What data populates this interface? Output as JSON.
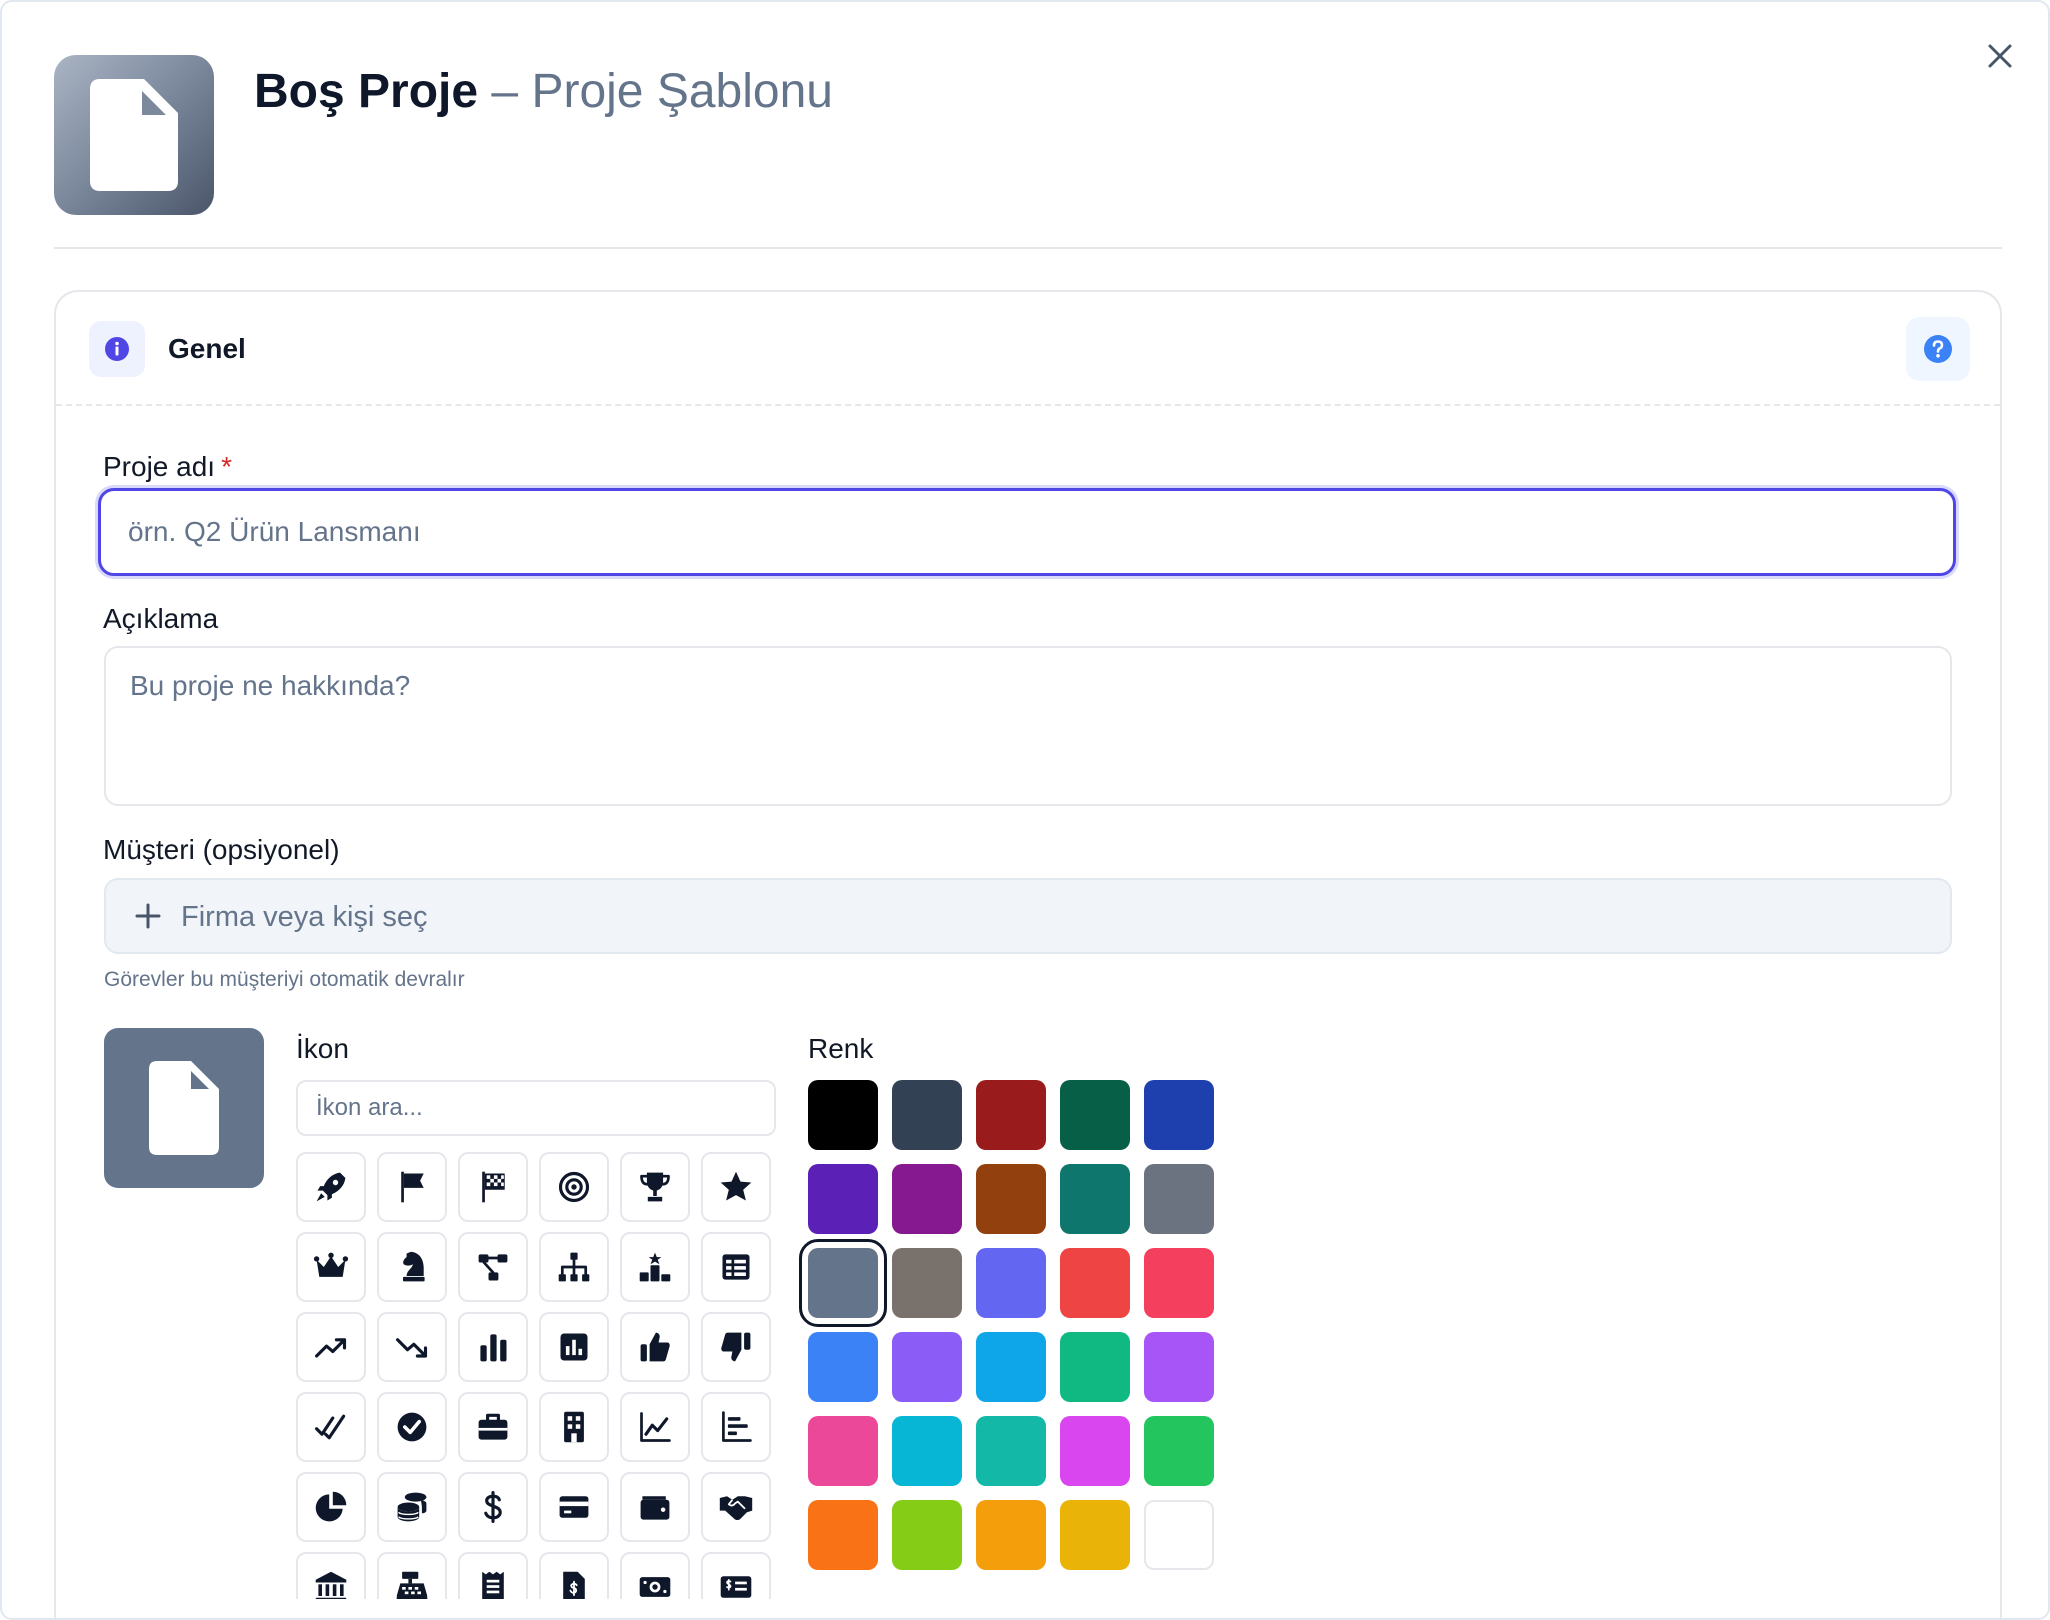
{
  "header": {
    "title": "Boş Proje",
    "separator": " – ",
    "subtitle": "Proje Şablonu",
    "icon": "file-icon",
    "close_icon": "close-icon"
  },
  "section": {
    "title": "Genel",
    "info_icon": "info-icon",
    "help_icon": "help-icon"
  },
  "form": {
    "name_label": "Proje adı",
    "required_mark": "*",
    "name_value": "",
    "name_placeholder": "örn. Q2 Ürün Lansmanı",
    "description_label": "Açıklama",
    "description_value": "",
    "description_placeholder": "Bu proje ne hakkında?",
    "client_label": "Müşteri (opsiyonel)",
    "client_placeholder": "Firma veya kişi seç",
    "client_help": "Görevler bu müşteriyi otomatik devralır"
  },
  "icon_picker": {
    "label": "İkon",
    "search_placeholder": "İkon ara...",
    "selected_icon": "file-icon",
    "icons": [
      "rocket-icon",
      "flag-icon",
      "checkered-flag-icon",
      "target-icon",
      "trophy-icon",
      "star-icon",
      "crown-icon",
      "chess-knight-icon",
      "workflow-icon",
      "org-chart-icon",
      "ranking-icon",
      "table-icon",
      "trend-up-icon",
      "trend-down-icon",
      "bar-chart-icon",
      "chart-square-icon",
      "thumbs-up-icon",
      "thumbs-down-icon",
      "double-check-icon",
      "check-circle-icon",
      "briefcase-icon",
      "building-icon",
      "line-chart-icon",
      "bar-chart-left-icon",
      "pie-chart-icon",
      "coins-icon",
      "dollar-icon",
      "credit-card-icon",
      "wallet-icon",
      "handshake-icon",
      "bank-icon",
      "cash-register-icon",
      "receipt-icon",
      "invoice-icon",
      "money-bill-icon",
      "money-check-icon"
    ]
  },
  "color_picker": {
    "label": "Renk",
    "selected": "#64748b",
    "colors": [
      "#000000",
      "#334155",
      "#991b1b",
      "#065f46",
      "#1e40af",
      "#5b21b6",
      "#86198f",
      "#92400e",
      "#0f766e",
      "#6b7280",
      "#64748b",
      "#78716c",
      "#6366f1",
      "#ef4444",
      "#f43f5e",
      "#3b82f6",
      "#8b5cf6",
      "#0ea5e9",
      "#10b981",
      "#a855f7",
      "#ec4899",
      "#06b6d4",
      "#14b8a6",
      "#d946ef",
      "#22c55e",
      "#f97316",
      "#84cc16",
      "#f59e0b",
      "#eab308",
      "#ffffff"
    ]
  }
}
